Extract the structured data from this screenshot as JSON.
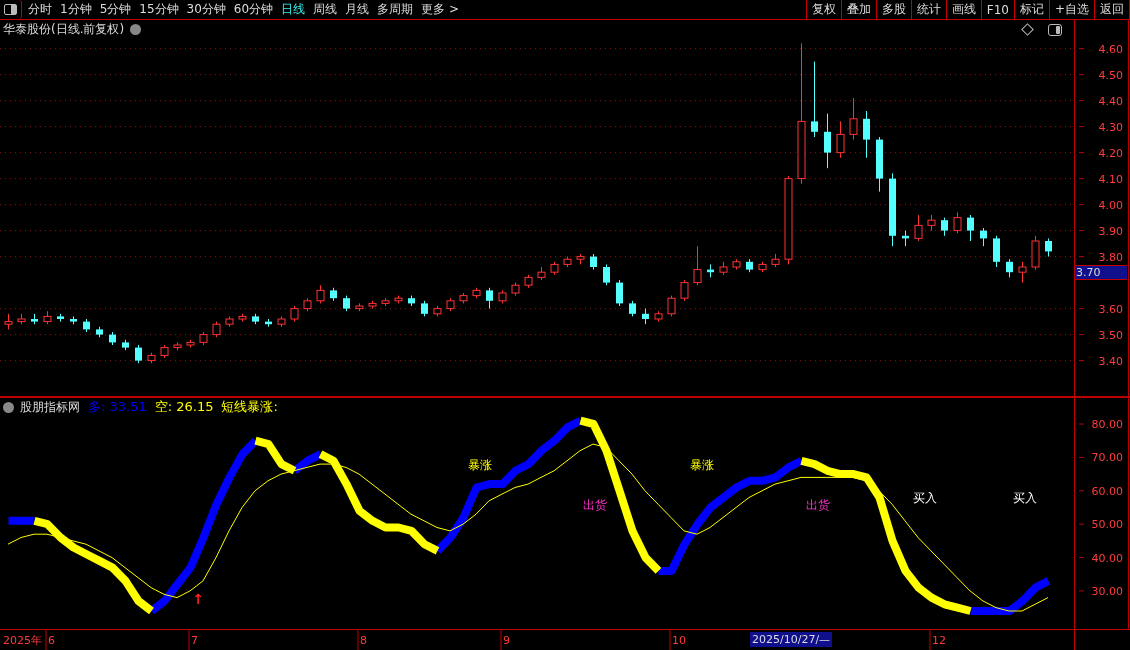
{
  "toolbar": {
    "tabs": [
      {
        "label": "分时",
        "selected": false
      },
      {
        "label": "1分钟",
        "selected": false
      },
      {
        "label": "5分钟",
        "selected": false
      },
      {
        "label": "15分钟",
        "selected": false
      },
      {
        "label": "30分钟",
        "selected": false
      },
      {
        "label": "60分钟",
        "selected": false
      },
      {
        "label": "日线",
        "selected": true
      },
      {
        "label": "周线",
        "selected": false
      },
      {
        "label": "月线",
        "selected": false
      },
      {
        "label": "多周期",
        "selected": false
      },
      {
        "label": "更多 >",
        "selected": false
      }
    ],
    "buttons": [
      "复权",
      "叠加",
      "多股",
      "统计",
      "画线",
      "F10",
      "标记",
      "+自选",
      "返回"
    ]
  },
  "price_panel": {
    "title": "华泰股份(日线.前复权)",
    "price_marker": "3.70",
    "chart_data": {
      "type": "candlestick",
      "grid": true,
      "ylim": [
        3.26,
        4.71
      ],
      "yticks": [
        {
          "value": 4.6,
          "label": "4.60"
        },
        {
          "value": 4.5,
          "label": "4.50"
        },
        {
          "value": 4.4,
          "label": "4.40"
        },
        {
          "value": 4.3,
          "label": "4.30"
        },
        {
          "value": 4.2,
          "label": "4.20"
        },
        {
          "value": 4.1,
          "label": "4.10"
        },
        {
          "value": 4.0,
          "label": "4.00"
        },
        {
          "value": 3.9,
          "label": "3.90"
        },
        {
          "value": 3.8,
          "label": "3.80"
        },
        {
          "value": 3.6,
          "label": "3.60"
        },
        {
          "value": 3.5,
          "label": "3.50"
        },
        {
          "value": 3.4,
          "label": "3.40"
        }
      ],
      "ohlc": [
        [
          3.54,
          3.58,
          3.52,
          3.55
        ],
        [
          3.55,
          3.58,
          3.54,
          3.56
        ],
        [
          3.56,
          3.58,
          3.54,
          3.55
        ],
        [
          3.55,
          3.59,
          3.54,
          3.57
        ],
        [
          3.57,
          3.58,
          3.55,
          3.56
        ],
        [
          3.56,
          3.57,
          3.54,
          3.55
        ],
        [
          3.55,
          3.56,
          3.51,
          3.52
        ],
        [
          3.52,
          3.53,
          3.49,
          3.5
        ],
        [
          3.5,
          3.51,
          3.46,
          3.47
        ],
        [
          3.47,
          3.48,
          3.44,
          3.45
        ],
        [
          3.45,
          3.46,
          3.39,
          3.4
        ],
        [
          3.4,
          3.43,
          3.39,
          3.42
        ],
        [
          3.42,
          3.46,
          3.41,
          3.45
        ],
        [
          3.45,
          3.47,
          3.44,
          3.46
        ],
        [
          3.46,
          3.48,
          3.45,
          3.47
        ],
        [
          3.47,
          3.51,
          3.46,
          3.5
        ],
        [
          3.5,
          3.55,
          3.49,
          3.54
        ],
        [
          3.54,
          3.57,
          3.53,
          3.56
        ],
        [
          3.56,
          3.58,
          3.55,
          3.57
        ],
        [
          3.57,
          3.58,
          3.54,
          3.55
        ],
        [
          3.55,
          3.56,
          3.53,
          3.54
        ],
        [
          3.54,
          3.57,
          3.53,
          3.56
        ],
        [
          3.56,
          3.61,
          3.55,
          3.6
        ],
        [
          3.6,
          3.64,
          3.59,
          3.63
        ],
        [
          3.63,
          3.69,
          3.62,
          3.67
        ],
        [
          3.67,
          3.68,
          3.63,
          3.64
        ],
        [
          3.64,
          3.65,
          3.59,
          3.6
        ],
        [
          3.6,
          3.62,
          3.59,
          3.61
        ],
        [
          3.61,
          3.63,
          3.6,
          3.62
        ],
        [
          3.62,
          3.64,
          3.61,
          3.63
        ],
        [
          3.63,
          3.65,
          3.62,
          3.64
        ],
        [
          3.64,
          3.65,
          3.61,
          3.62
        ],
        [
          3.62,
          3.63,
          3.57,
          3.58
        ],
        [
          3.58,
          3.61,
          3.57,
          3.6
        ],
        [
          3.6,
          3.64,
          3.59,
          3.63
        ],
        [
          3.63,
          3.66,
          3.62,
          3.65
        ],
        [
          3.65,
          3.68,
          3.64,
          3.67
        ],
        [
          3.67,
          3.68,
          3.6,
          3.63
        ],
        [
          3.63,
          3.67,
          3.62,
          3.66
        ],
        [
          3.66,
          3.7,
          3.65,
          3.69
        ],
        [
          3.69,
          3.73,
          3.68,
          3.72
        ],
        [
          3.72,
          3.76,
          3.71,
          3.74
        ],
        [
          3.74,
          3.78,
          3.73,
          3.77
        ],
        [
          3.77,
          3.8,
          3.76,
          3.79
        ],
        [
          3.79,
          3.81,
          3.77,
          3.8
        ],
        [
          3.8,
          3.81,
          3.75,
          3.76
        ],
        [
          3.76,
          3.77,
          3.69,
          3.7
        ],
        [
          3.7,
          3.71,
          3.61,
          3.62
        ],
        [
          3.62,
          3.63,
          3.57,
          3.58
        ],
        [
          3.58,
          3.6,
          3.54,
          3.56
        ],
        [
          3.56,
          3.59,
          3.55,
          3.58
        ],
        [
          3.58,
          3.65,
          3.57,
          3.64
        ],
        [
          3.64,
          3.71,
          3.63,
          3.7
        ],
        [
          3.7,
          3.84,
          3.69,
          3.75
        ],
        [
          3.75,
          3.77,
          3.72,
          3.74
        ],
        [
          3.74,
          3.78,
          3.73,
          3.76
        ],
        [
          3.76,
          3.79,
          3.75,
          3.78
        ],
        [
          3.78,
          3.79,
          3.74,
          3.75
        ],
        [
          3.75,
          3.78,
          3.74,
          3.77
        ],
        [
          3.77,
          3.81,
          3.76,
          3.79
        ],
        [
          3.79,
          4.11,
          3.77,
          4.1
        ],
        [
          4.1,
          4.62,
          4.08,
          4.32
        ],
        [
          4.32,
          4.55,
          4.26,
          4.28
        ],
        [
          4.28,
          4.35,
          4.14,
          4.2
        ],
        [
          4.2,
          4.32,
          4.18,
          4.27
        ],
        [
          4.27,
          4.41,
          4.25,
          4.33
        ],
        [
          4.33,
          4.36,
          4.18,
          4.25
        ],
        [
          4.25,
          4.26,
          4.05,
          4.1
        ],
        [
          4.1,
          4.12,
          3.84,
          3.88
        ],
        [
          3.88,
          3.9,
          3.84,
          3.87
        ],
        [
          3.87,
          3.96,
          3.86,
          3.92
        ],
        [
          3.92,
          3.96,
          3.9,
          3.94
        ],
        [
          3.94,
          3.95,
          3.88,
          3.9
        ],
        [
          3.9,
          3.97,
          3.89,
          3.95
        ],
        [
          3.95,
          3.96,
          3.86,
          3.9
        ],
        [
          3.9,
          3.91,
          3.84,
          3.87
        ],
        [
          3.87,
          3.88,
          3.76,
          3.78
        ],
        [
          3.78,
          3.79,
          3.72,
          3.74
        ],
        [
          3.74,
          3.78,
          3.7,
          3.76
        ],
        [
          3.76,
          3.88,
          3.75,
          3.86
        ],
        [
          3.86,
          3.87,
          3.8,
          3.82
        ]
      ]
    }
  },
  "indicator_panel": {
    "name": "股朋指标网",
    "legend": [
      {
        "label": "多: 33.51",
        "color": "#0000ff"
      },
      {
        "label": "空: 26.15",
        "color": "#ffff00"
      },
      {
        "label": "短线暴涨:",
        "color": "#ffff00"
      }
    ],
    "chart_data": {
      "type": "line",
      "ylim": [
        18.3,
        88.1
      ],
      "yticks": [
        {
          "value": 80,
          "label": "80.00"
        },
        {
          "value": 70,
          "label": "70.00"
        },
        {
          "value": 60,
          "label": "60.00"
        },
        {
          "value": 50,
          "label": "50.00"
        },
        {
          "value": 40,
          "label": "40.00"
        },
        {
          "value": 30,
          "label": "30.00"
        }
      ],
      "series": [
        {
          "color": "#0000ff",
          "values": [
            51,
            51,
            51,
            null,
            null,
            null,
            null,
            null,
            null,
            null,
            null,
            24,
            27,
            32,
            37,
            46,
            56,
            64,
            71,
            75,
            null,
            null,
            66,
            69,
            71,
            null,
            null,
            null,
            null,
            null,
            null,
            null,
            null,
            42,
            46,
            52,
            61,
            62,
            62,
            66,
            68,
            72,
            75,
            79,
            81,
            null,
            null,
            null,
            null,
            null,
            36,
            36,
            44,
            50,
            55,
            58,
            61,
            63,
            63,
            64,
            67,
            69,
            null,
            null,
            null,
            null,
            null,
            null,
            null,
            null,
            null,
            null,
            null,
            null,
            24,
            24,
            24,
            24,
            27,
            31,
            33
          ]
        },
        {
          "color": "#ffff00",
          "values": [
            null,
            null,
            51,
            50,
            46,
            43,
            41,
            39,
            37,
            33,
            27,
            24,
            null,
            null,
            null,
            null,
            null,
            null,
            null,
            75,
            74,
            68,
            66,
            null,
            71,
            69,
            62,
            54,
            51,
            49,
            49,
            48,
            44,
            42,
            null,
            null,
            null,
            null,
            null,
            null,
            null,
            null,
            null,
            null,
            81,
            80,
            72,
            60,
            48,
            40,
            36,
            null,
            null,
            null,
            null,
            null,
            null,
            null,
            null,
            null,
            null,
            69,
            68,
            66,
            65,
            65,
            64,
            58,
            45,
            36,
            31,
            28,
            26,
            25,
            24,
            null,
            null,
            null,
            null,
            null,
            null
          ]
        },
        {
          "color": "#ffff00",
          "values": [
            44,
            46,
            47,
            47,
            46,
            45,
            44,
            42,
            40,
            37,
            34,
            31,
            29,
            28,
            30,
            33,
            40,
            48,
            55,
            60,
            63,
            65,
            66,
            67,
            68,
            68,
            67,
            65,
            62,
            59,
            56,
            53,
            51,
            49,
            48,
            50,
            53,
            57,
            59,
            61,
            62,
            64,
            66,
            69,
            72,
            74,
            73,
            69,
            65,
            60,
            56,
            52,
            48,
            47,
            49,
            52,
            55,
            58,
            60,
            62,
            63,
            64,
            64,
            64,
            64,
            64,
            63,
            60,
            56,
            51,
            46,
            42,
            38,
            34,
            30,
            27,
            25,
            24,
            24,
            26,
            28
          ]
        }
      ]
    },
    "signals": [
      {
        "text": "暴涨",
        "kind": "surge"
      },
      {
        "text": "出货",
        "kind": "sell"
      },
      {
        "text": "暴涨",
        "kind": "surge"
      },
      {
        "text": "出货",
        "kind": "sell"
      },
      {
        "text": "买入",
        "kind": "buy"
      },
      {
        "text": "买入",
        "kind": "buy"
      },
      {
        "text": "↑",
        "kind": "arrow"
      }
    ]
  },
  "date_axis": {
    "year": "2025年",
    "months": [
      "6",
      "7",
      "8",
      "9",
      "10",
      "12"
    ],
    "cursor": "2025/10/27/—"
  }
}
